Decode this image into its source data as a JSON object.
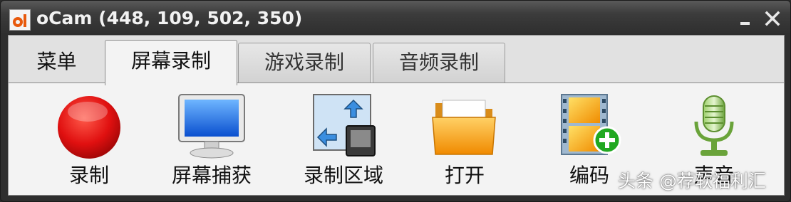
{
  "window": {
    "title": "oCam (448, 109, 502, 350)",
    "icon": "ocam-app-icon",
    "controls": [
      "minimize-icon",
      "close-icon"
    ]
  },
  "tabs": [
    {
      "label": "菜单",
      "state": "plain"
    },
    {
      "label": "屏幕录制",
      "state": "active"
    },
    {
      "label": "游戏录制",
      "state": "inactive"
    },
    {
      "label": "音频录制",
      "state": "inactive"
    }
  ],
  "toolbar": [
    {
      "label": "录制",
      "icon": "record-icon"
    },
    {
      "label": "屏幕捕获",
      "icon": "monitor-icon"
    },
    {
      "label": "录制区域",
      "icon": "region-icon"
    },
    {
      "label": "打开",
      "icon": "folder-icon"
    },
    {
      "label": "编码",
      "icon": "film-add-icon"
    },
    {
      "label": "声音",
      "icon": "microphone-icon"
    }
  ],
  "watermark": "头条 @荐软福利汇",
  "colors": {
    "titlebar": "#3c3c3c",
    "client": "#e1e1e1",
    "panel": "#f3f3f3",
    "record_red": "#e01010"
  }
}
